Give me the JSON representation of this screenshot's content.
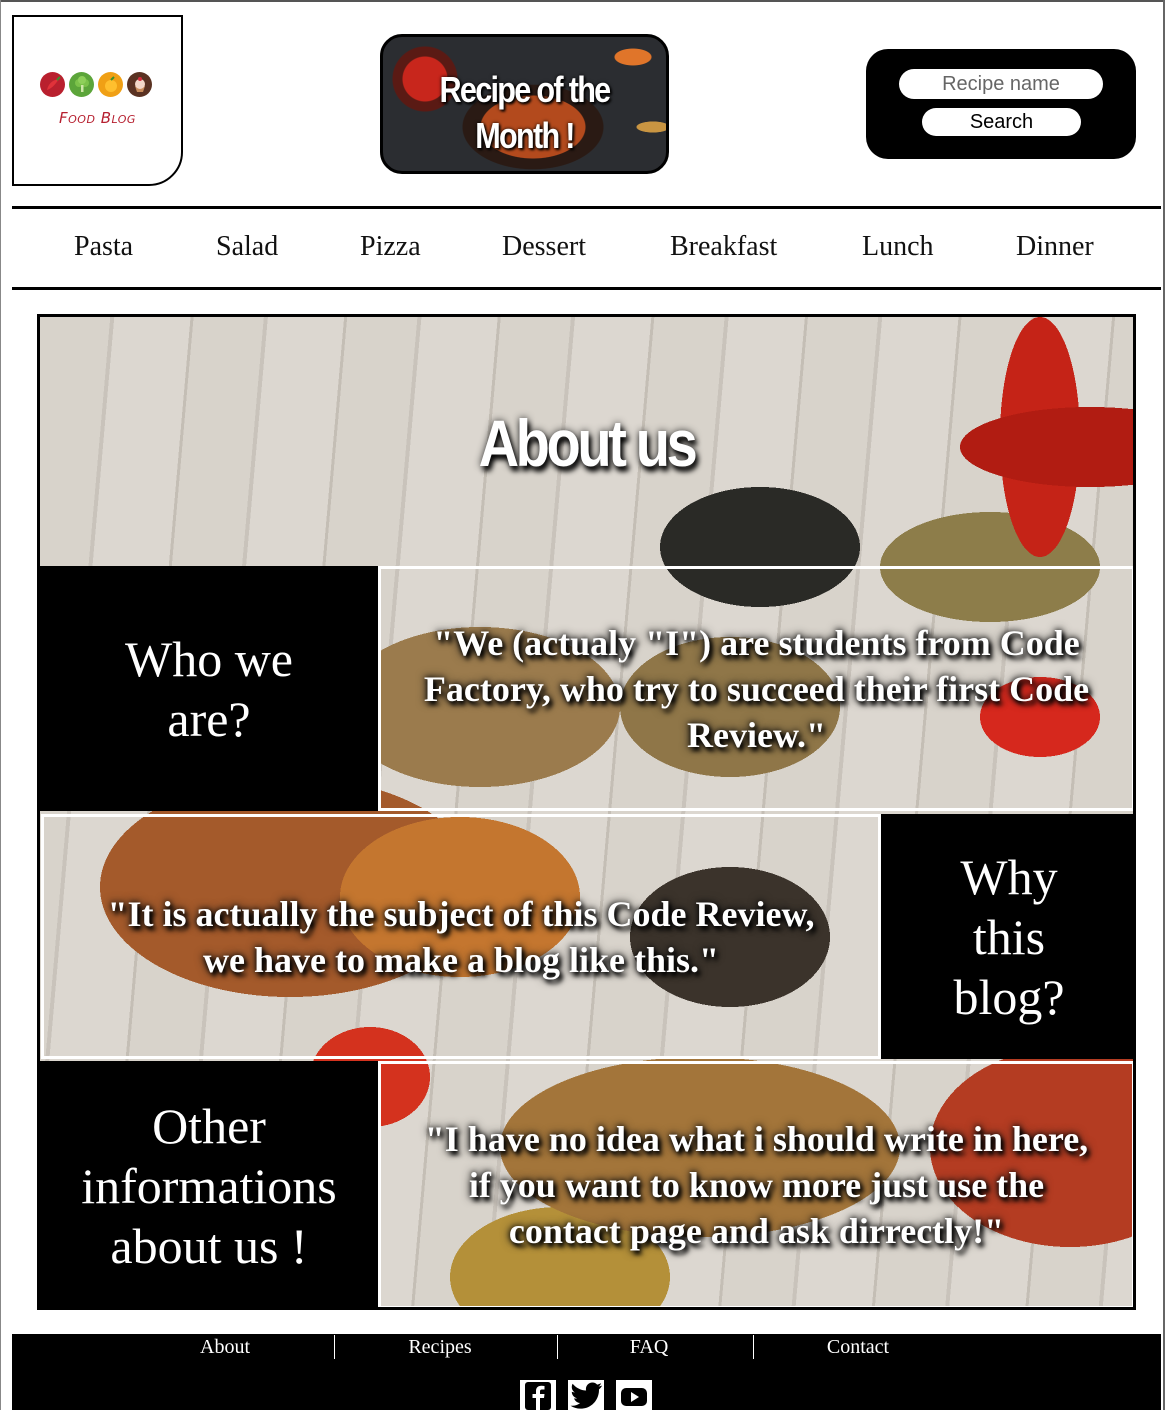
{
  "logo": {
    "text": "Food Blog",
    "icons": [
      "pepper-icon",
      "broccoli-icon",
      "orange-icon",
      "cupcake-icon"
    ],
    "text_color": "#b61f2f"
  },
  "promo": {
    "title": "Recipe of the Month !"
  },
  "search": {
    "placeholder": "Recipe name",
    "button_label": "Search"
  },
  "nav": {
    "items": [
      "Pasta",
      "Salad",
      "Pizza",
      "Dessert",
      "Breakfast",
      "Lunch",
      "Dinner"
    ]
  },
  "about": {
    "title": "About us",
    "sections": [
      {
        "heading": "Who we are?",
        "quote": "\"We (actualy \"I\") are students from Code Factory, who try to succeed their first Code Review.\""
      },
      {
        "heading": "Why this blog?",
        "quote": "\"It is actually the subject of this Code Review, we have to make a blog like this.\""
      },
      {
        "heading": "Other informations about us !",
        "quote": "\"I have no idea what i should write in here, if you want to know more just use the contact page and ask dirrectly!\""
      }
    ]
  },
  "footer": {
    "links": [
      "About",
      "Recipes",
      "FAQ",
      "Contact"
    ],
    "social": [
      "facebook-icon",
      "twitter-icon",
      "youtube-icon"
    ]
  },
  "colors": {
    "background": "#ffffff",
    "panel": "#000000",
    "accent": "#b61f2f"
  }
}
